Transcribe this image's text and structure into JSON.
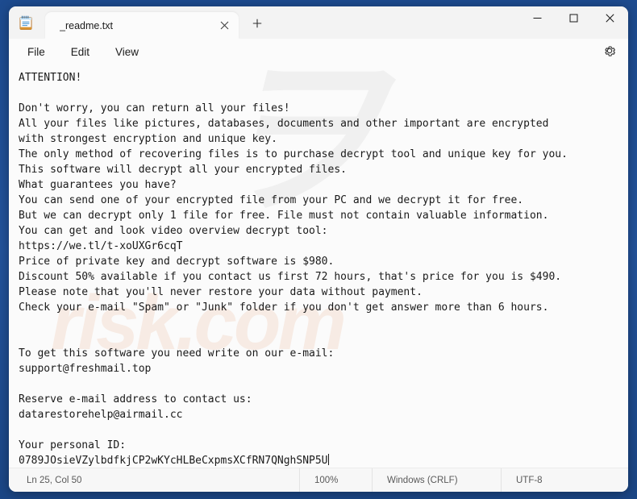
{
  "window": {
    "app_icon": "notepad-icon",
    "controls": {
      "minimize": "minimize-icon",
      "maximize": "maximize-icon",
      "close": "close-icon"
    }
  },
  "tabs": [
    {
      "label": "_readme.txt",
      "close_icon": "close-icon",
      "active": true
    }
  ],
  "newtab": {
    "icon": "plus-icon",
    "label": "+"
  },
  "menubar": {
    "items": [
      {
        "label": "File"
      },
      {
        "label": "Edit"
      },
      {
        "label": "View"
      }
    ],
    "settings_icon": "gear-icon"
  },
  "watermark": {
    "glyph": "ヲ",
    "text": "risk.com"
  },
  "document": {
    "filename": "_readme.txt",
    "lines": [
      "ATTENTION!",
      "",
      "Don't worry, you can return all your files!",
      "All your files like pictures, databases, documents and other important are encrypted",
      "with strongest encryption and unique key.",
      "The only method of recovering files is to purchase decrypt tool and unique key for you.",
      "This software will decrypt all your encrypted files.",
      "What guarantees you have?",
      "You can send one of your encrypted file from your PC and we decrypt it for free.",
      "But we can decrypt only 1 file for free. File must not contain valuable information.",
      "You can get and look video overview decrypt tool:",
      "https://we.tl/t-xoUXGr6cqT",
      "Price of private key and decrypt software is $980.",
      "Discount 50% available if you contact us first 72 hours, that's price for you is $490.",
      "Please note that you'll never restore your data without payment.",
      "Check your e-mail \"Spam\" or \"Junk\" folder if you don't get answer more than 6 hours.",
      "",
      "",
      "To get this software you need write on our e-mail:",
      "support@freshmail.top",
      "",
      "Reserve e-mail address to contact us:",
      "datarestorehelp@airmail.cc",
      "",
      "Your personal ID:",
      "0789JOsieVZylbdfkjCP2wKYcHLBeCxpmsXCfRN7QNghSNP5U"
    ],
    "video_url": "https://we.tl/t-xoUXGr6cqT",
    "price_full": "$980",
    "price_discount": "$490",
    "discount_percent": "50%",
    "discount_window_hours": "72",
    "response_time_hours": "6",
    "free_decrypt_files": "1",
    "primary_email": "support@freshmail.top",
    "reserve_email": "datarestorehelp@airmail.cc",
    "personal_id": "0789JOsieVZylbdfkjCP2wKYcHLBeCxpmsXCfRN7QNghSNP5U"
  },
  "statusbar": {
    "position": "Ln 25, Col 50",
    "zoom": "100%",
    "line_ending": "Windows (CRLF)",
    "encoding": "UTF-8"
  },
  "colors": {
    "desktop": "#1f4e93",
    "window_bg": "#f3f3f3",
    "editor_bg": "#fbfbfb",
    "text": "#1a1a1a",
    "close_hover": "#c42b1c",
    "watermark_orange": "#e2844a"
  }
}
